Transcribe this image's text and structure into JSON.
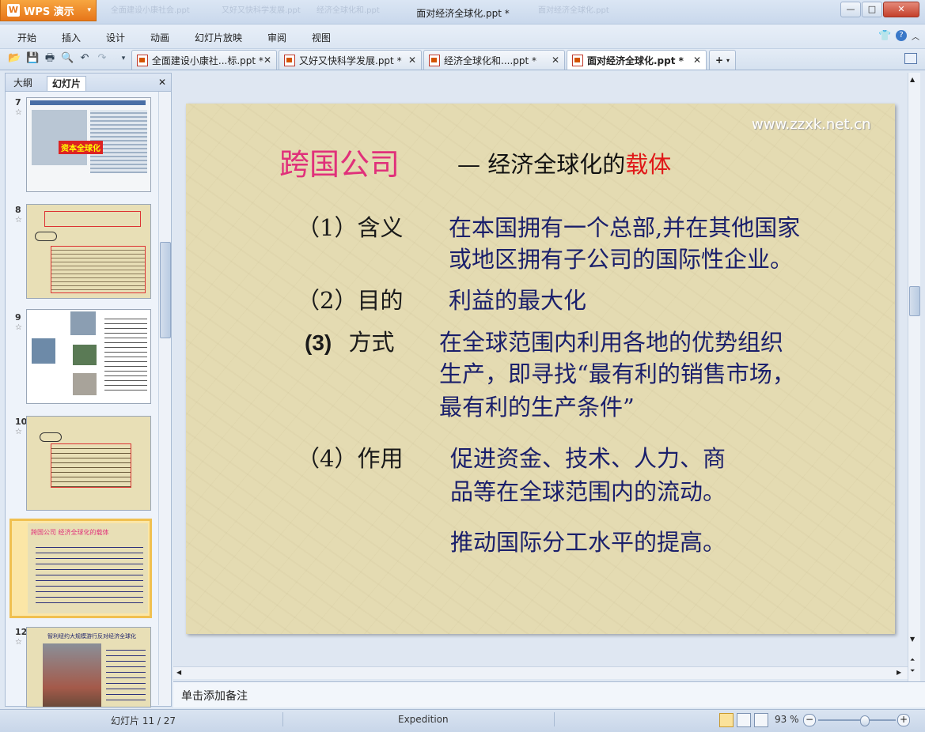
{
  "app": {
    "name": "WPS 演示",
    "logo_letter": "W",
    "dropdown": "▾"
  },
  "window": {
    "title": "面对经济全球化.ppt *",
    "ghost_tabs": [
      "全面建设小康社会.ppt",
      "又好又快科学发展.ppt",
      "经济全球化和.ppt",
      "面对经济全球化.ppt"
    ],
    "minimize": "—",
    "maximize": "□",
    "close": "✕"
  },
  "menu": [
    "开始",
    "插入",
    "设计",
    "动画",
    "幻灯片放映",
    "审阅",
    "视图"
  ],
  "menu_right_icons": [
    "shirt-icon",
    "help-icon",
    "chevron-icon"
  ],
  "doc_tabs": [
    {
      "label": "全面建设小康社...标.ppt *",
      "active": false
    },
    {
      "label": "又好又快科学发展.ppt *",
      "active": false
    },
    {
      "label": "经济全球化和....ppt *",
      "active": false
    },
    {
      "label": "面对经济全球化.ppt *",
      "active": true
    }
  ],
  "tab_close": "✕",
  "new_tab": "+",
  "left_panel": {
    "tabs": [
      "大纲",
      "幻灯片"
    ],
    "active_tab": "幻灯片",
    "close": "✕",
    "thumbnails": [
      {
        "number": "7",
        "caption": "资本全球化"
      },
      {
        "number": "8",
        "caption": ""
      },
      {
        "number": "9",
        "caption": ""
      },
      {
        "number": "10",
        "caption": ""
      },
      {
        "number": "11",
        "caption": "跨国公司  经济全球化的载体",
        "selected": true
      },
      {
        "number": "12",
        "caption": "智利纽约大规模游行反对经济全球化"
      }
    ],
    "star": "☆"
  },
  "slide": {
    "watermark": "www.zzxk.net.cn",
    "title": "跨国公司",
    "subtitle_prefix": "— 经济全球化的",
    "subtitle_highlight": "载体",
    "items": [
      {
        "label": "（1）含义",
        "text1": "在本国拥有一个总部,并在其他国家",
        "text2": "或地区拥有子公司的国际性企业。"
      },
      {
        "label": "（2）目的",
        "text1": "利益的最大化"
      },
      {
        "label_num": "(3)",
        "label_text": "方式",
        "text1": "在全球范围内利用各地的优势组织",
        "text2": "生产，即寻找“最有利的销售市场，",
        "text3": "最有利的生产条件”"
      },
      {
        "label": "（4）作用",
        "text1": "促进资金、技术、人力、商",
        "text2": "品等在全球范围内的流动。",
        "text3": "推动国际分工水平的提高。"
      }
    ]
  },
  "notes_placeholder": "单击添加备注",
  "status": {
    "slide_info": "幻灯片 11 / 27",
    "theme": "Expedition",
    "zoom": "93 %",
    "zoom_level": 0.62
  },
  "colors": {
    "title": "#e0307a",
    "highlight": "#e01818",
    "body": "#1a1f6b",
    "label": "#1a1a1a"
  }
}
